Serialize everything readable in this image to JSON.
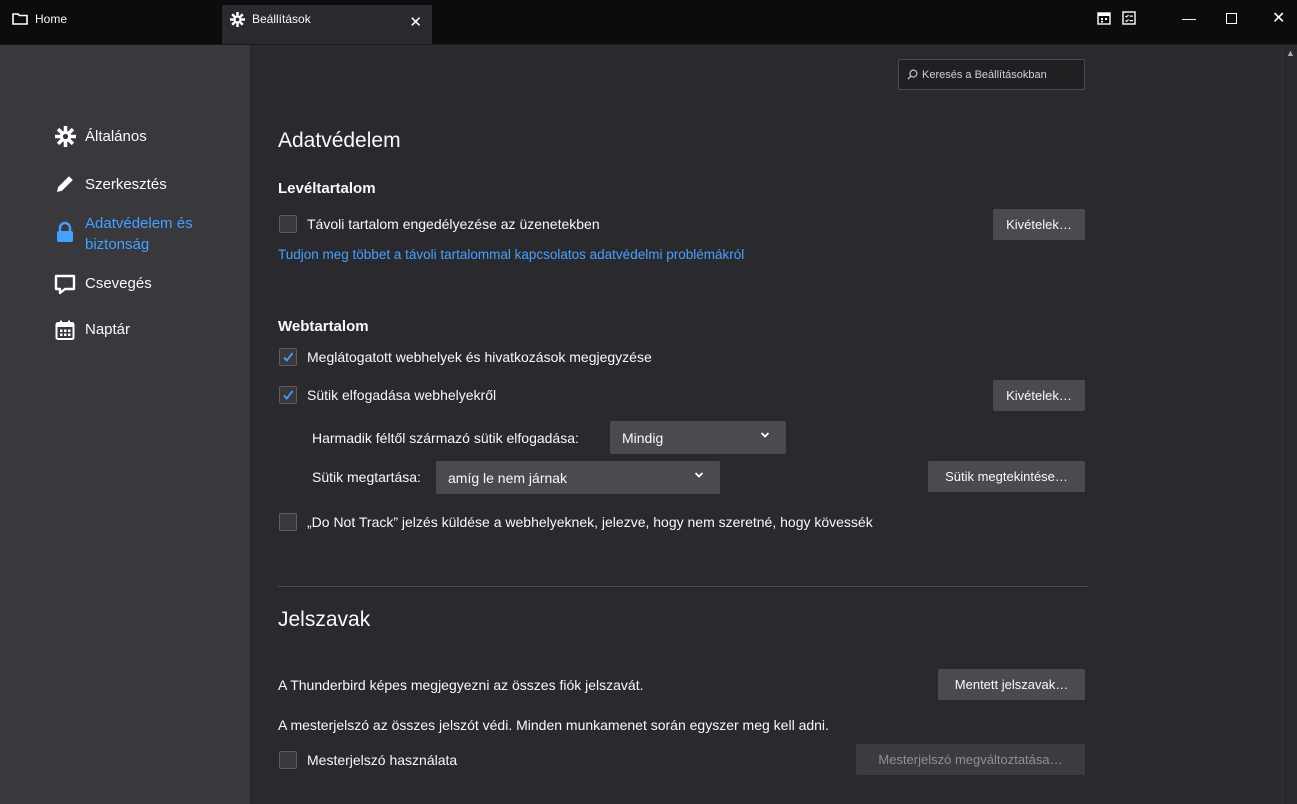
{
  "tabs": {
    "home_label": "Home",
    "settings_label": "Beállítások",
    "close_symbol": "✕"
  },
  "window_controls": {
    "minimize": "—",
    "maximize": "☐",
    "close": "✕"
  },
  "icons": {
    "toolbar": [
      "calendar-icon",
      "tasks-icon"
    ]
  },
  "search": {
    "placeholder": "Keresés a Beállításokban"
  },
  "sidebar": {
    "items": [
      {
        "label": "Általános",
        "icon": "gear-icon"
      },
      {
        "label": "Szerkesztés",
        "icon": "pencil-icon"
      },
      {
        "label": "Adatvédelem és biztonság",
        "icon": "lock-icon",
        "active": true
      },
      {
        "label": "Csevegés",
        "icon": "chat-icon"
      },
      {
        "label": "Naptár",
        "icon": "calendar-icon"
      }
    ]
  },
  "privacy": {
    "title": "Adatvédelem",
    "mail_content": {
      "heading": "Levéltartalom",
      "remote_checkbox": "Távoli tartalom engedélyezése az üzenetekben",
      "remote_checked": false,
      "exceptions_button": "Kivételek…",
      "learn_more_link": "Tudjon meg többet a távoli tartalommal kapcsolatos adatvédelmi problémákról"
    },
    "web_content": {
      "heading": "Webtartalom",
      "remember_visited": "Meglátogatott webhelyek és hivatkozások megjegyzése",
      "remember_visited_checked": true,
      "accept_cookies": "Sütik elfogadása webhelyekről",
      "accept_cookies_checked": true,
      "exceptions_button": "Kivételek…",
      "third_party_label": "Harmadik féltől származó sütik elfogadása:",
      "third_party_value": "Mindig",
      "keep_label": "Sütik megtartása:",
      "keep_value": "amíg le nem járnak",
      "show_cookies_button": "Sütik megtekintése…",
      "dnt_checkbox": "„Do Not Track” jelzés küldése a webhelyeknek, jelezve, hogy nem szeretné, hogy kövessék",
      "dnt_checked": false
    }
  },
  "passwords": {
    "title": "Jelszavak",
    "remember_text": "A Thunderbird képes megjegyezni az összes fiók jelszavát.",
    "saved_button": "Mentett jelszavak…",
    "master_text": "A mesterjelszó az összes jelszót védi. Minden munkamenet során egyszer meg kell adni.",
    "use_master": "Mesterjelszó használata",
    "use_master_checked": false,
    "change_master_button": "Mesterjelszó megváltoztatása…"
  },
  "colors": {
    "accent": "#45a1ff",
    "background": "#2a2a2e",
    "sidebar": "#38383d"
  }
}
